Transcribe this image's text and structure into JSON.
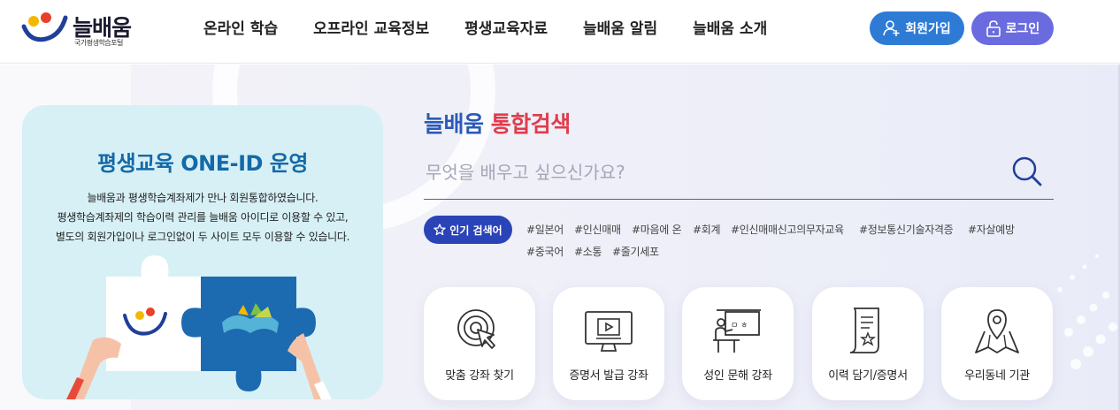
{
  "header": {
    "logo_text": "늘배움",
    "logo_sub": "국가평생학습포털",
    "nav": [
      "온라인 학습",
      "오프라인 교육정보",
      "평생교육자료",
      "늘배움 알림",
      "늘배움 소개"
    ],
    "join_label": "회원가입",
    "login_label": "로그인"
  },
  "promo": {
    "title": "평생교육 ONE-ID 운영",
    "desc": [
      "늘배움과 평생학습계좌제가 만나 회원통합하였습니다.",
      "평생학습계좌제의 학습이력 관리를 늘배움 아이디로 이용할 수 있고,",
      "별도의 회원가입이나 로그인없이 두 사이트 모두 이용할 수 있습니다."
    ]
  },
  "search": {
    "title_part1": "늘배움",
    "title_part2": "통합검색",
    "placeholder": "무엇을 배우고 싶으신가요?",
    "popular_label": "인기 검색어",
    "keywords": [
      "#일본어",
      "#인신매매",
      "#마음에 온",
      "#회계",
      "#인신매매신고의무자교육",
      "#정보통신기술자격증",
      "#자살예방",
      "#중국어",
      "#소통",
      "#줄기세포"
    ]
  },
  "cards": [
    {
      "label": "맞춤 강좌 찾기",
      "icon": "target-cursor-icon"
    },
    {
      "label": "증명서 발급 강좌",
      "icon": "video-monitor-icon"
    },
    {
      "label": "성인 문해 강좌",
      "icon": "classroom-board-icon"
    },
    {
      "label": "이력 담기/증명서",
      "icon": "certificate-document-icon"
    },
    {
      "label": "우리동네 기관",
      "icon": "map-pin-icon"
    }
  ],
  "colors": {
    "join_button": "#2e7bd6",
    "login_button": "#6b6be0",
    "popular_badge": "#2a44b8",
    "title_blue": "#2a5ab8",
    "title_red": "#e03c4b",
    "promo_bg": "#d7f0f5"
  }
}
